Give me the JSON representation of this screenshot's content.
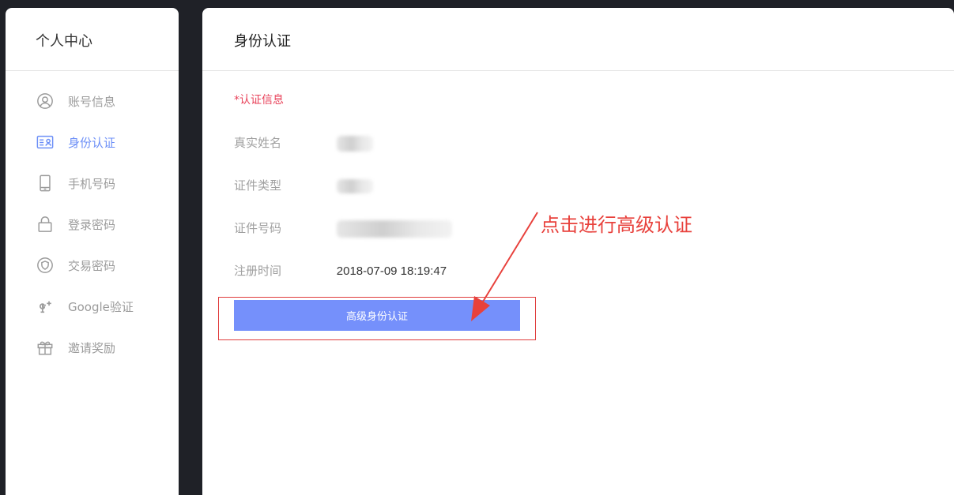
{
  "sidebar": {
    "title": "个人中心",
    "items": [
      {
        "label": "账号信息",
        "icon": "user-circle-icon",
        "active": false
      },
      {
        "label": "身份认证",
        "icon": "id-card-icon",
        "active": true
      },
      {
        "label": "手机号码",
        "icon": "phone-icon",
        "active": false
      },
      {
        "label": "登录密码",
        "icon": "lock-icon",
        "active": false
      },
      {
        "label": "交易密码",
        "icon": "shield-icon",
        "active": false
      },
      {
        "label": "Google验证",
        "icon": "google-plus-icon",
        "active": false
      },
      {
        "label": "邀请奖励",
        "icon": "gift-icon",
        "active": false
      }
    ]
  },
  "main": {
    "title": "身份认证",
    "section_title": "*认证信息",
    "fields": [
      {
        "label": "真实姓名",
        "value": ""
      },
      {
        "label": "证件类型",
        "value": ""
      },
      {
        "label": "证件号码",
        "value": ""
      },
      {
        "label": "注册时间",
        "value": "2018-07-09 18:19:47"
      }
    ],
    "button_label": "高级身份认证"
  },
  "annotation": {
    "text": "点击进行高级认证"
  },
  "colors": {
    "accent": "#6c8ff7",
    "button": "#7590fb",
    "alert": "#e8425a",
    "annotation": "#e8413c"
  }
}
